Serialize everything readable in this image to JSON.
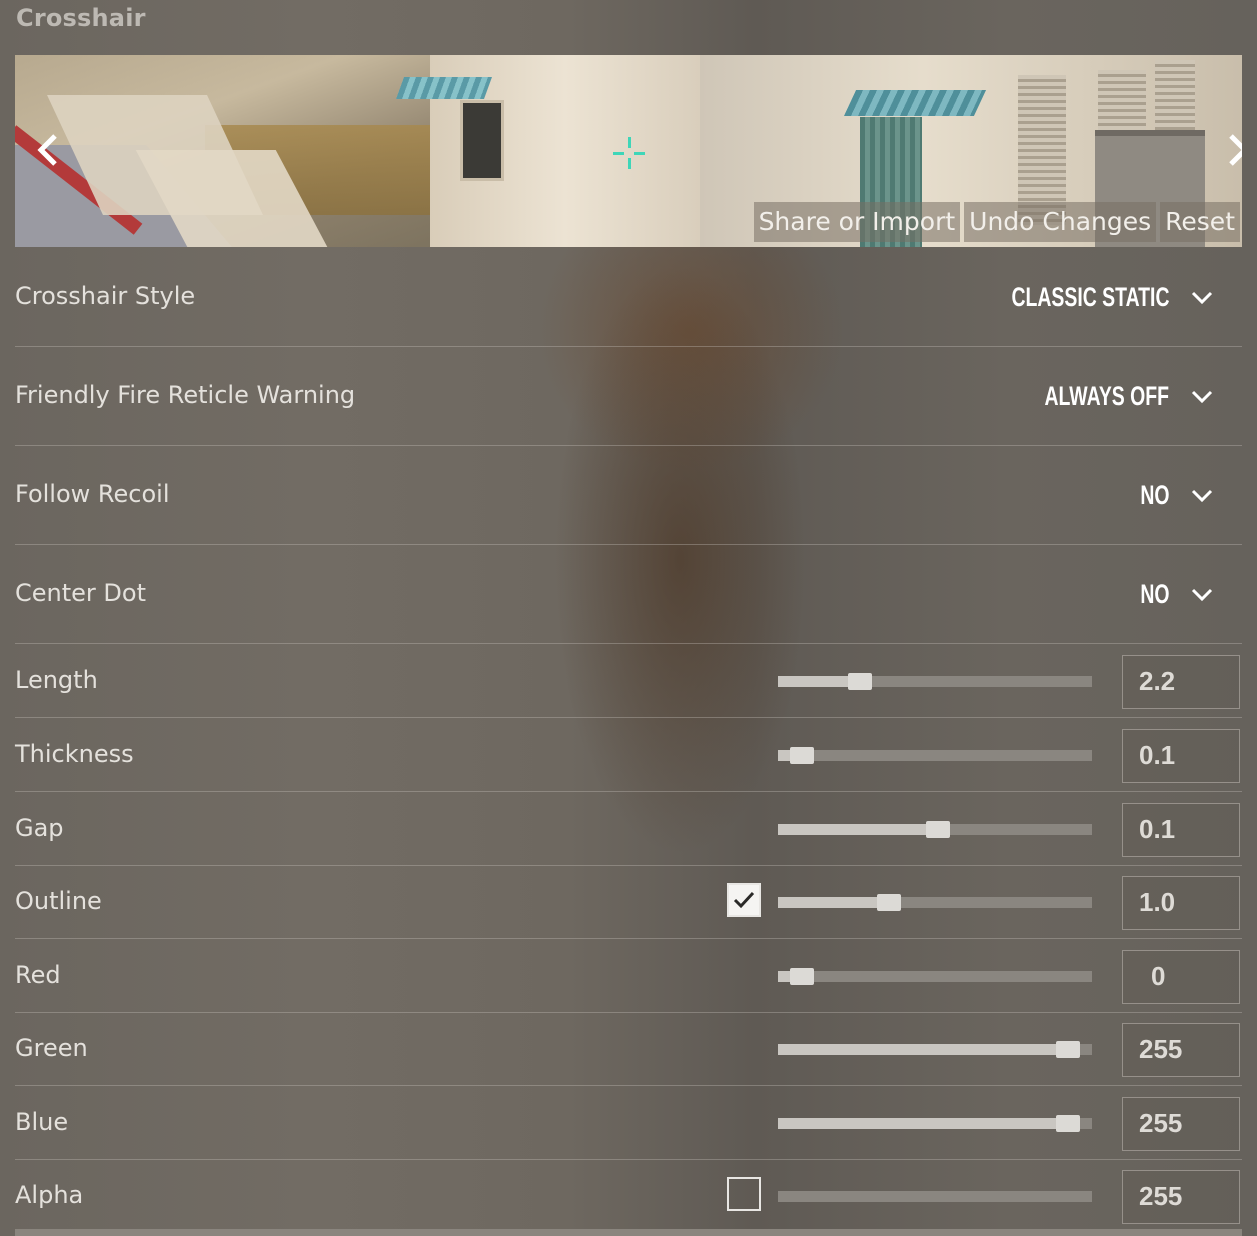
{
  "section_title": "Crosshair",
  "preview": {
    "share_label": "Share or Import",
    "undo_label": "Undo Changes",
    "reset_label": "Reset",
    "prev_arrow": "‹",
    "next_arrow": "›"
  },
  "dropdowns": [
    {
      "label": "Crosshair Style",
      "value": "CLASSIC STATIC"
    },
    {
      "label": "Friendly Fire Reticle Warning",
      "value": "ALWAYS OFF"
    },
    {
      "label": "Follow Recoil",
      "value": "NO"
    },
    {
      "label": "Center Dot",
      "value": "NO"
    }
  ],
  "sliders": [
    {
      "label": "Length",
      "value": "2.2",
      "fraction": 0.24,
      "has_checkbox": false
    },
    {
      "label": "Thickness",
      "value": "0.1",
      "fraction": 0.04,
      "has_checkbox": false
    },
    {
      "label": "Gap",
      "value": "0.1",
      "fraction": 0.51,
      "has_checkbox": false
    },
    {
      "label": "Outline",
      "value": "1.0",
      "fraction": 0.34,
      "has_checkbox": true,
      "checked": true
    },
    {
      "label": "Red",
      "value": "0",
      "fraction": 0.04,
      "has_checkbox": false
    },
    {
      "label": "Green",
      "value": "255",
      "fraction": 0.96,
      "has_checkbox": false
    },
    {
      "label": "Blue",
      "value": "255",
      "fraction": 0.96,
      "has_checkbox": false
    },
    {
      "label": "Alpha",
      "value": "255",
      "fraction": 0.0,
      "has_checkbox": true,
      "checked": false
    }
  ],
  "colors": {
    "crosshair": "#3fd6b8"
  }
}
